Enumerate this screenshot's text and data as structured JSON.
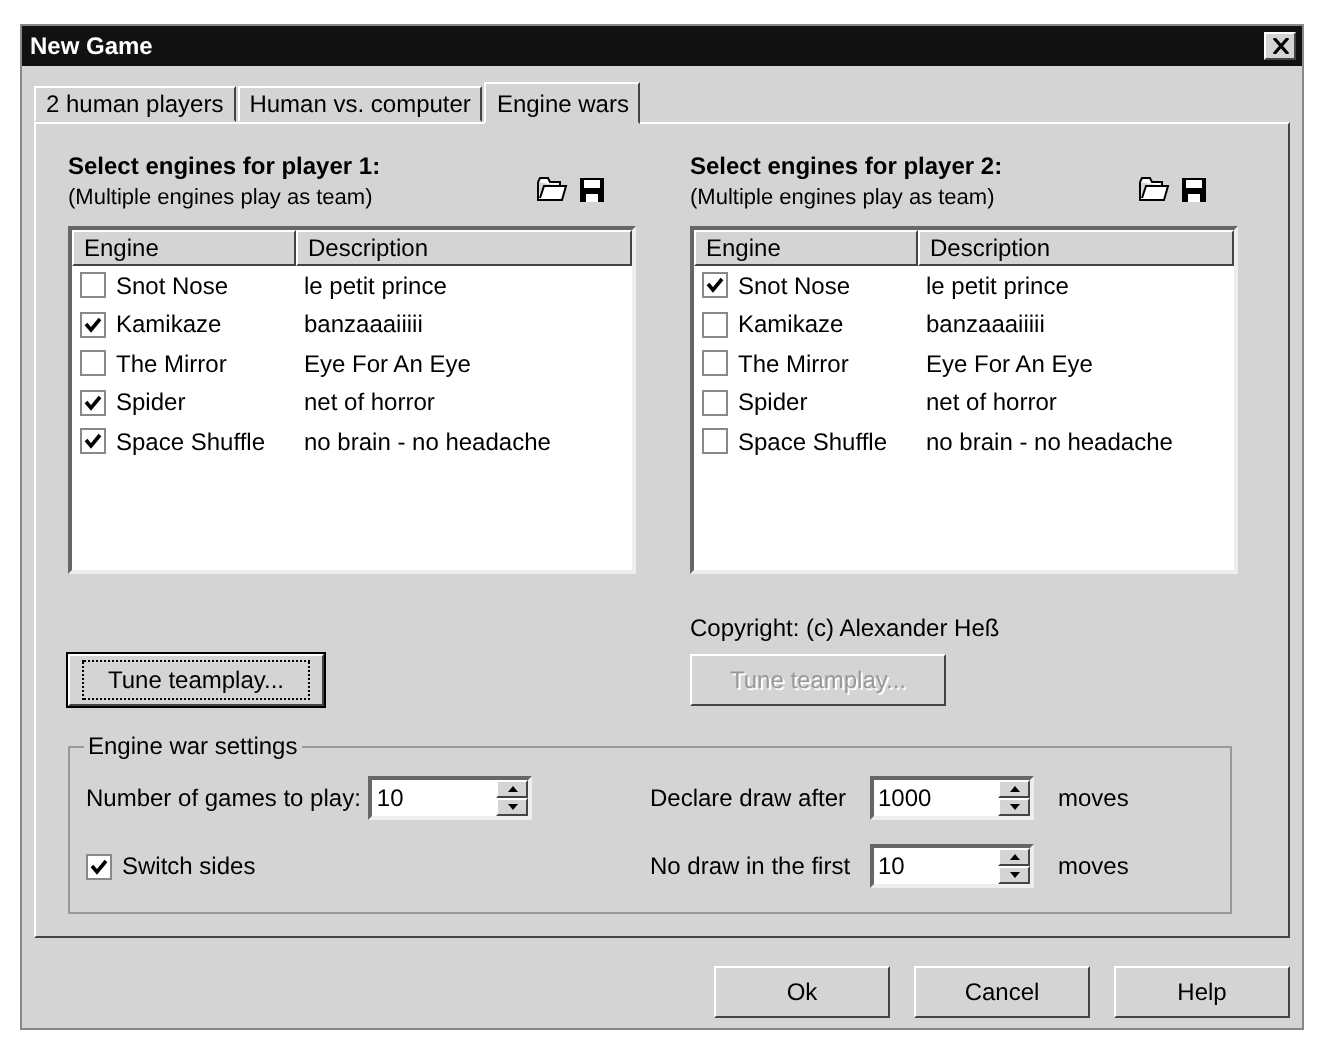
{
  "window": {
    "title": "New Game"
  },
  "tabs": [
    {
      "label": "2 human players",
      "selected": false
    },
    {
      "label": "Human vs. computer",
      "selected": false
    },
    {
      "label": "Engine wars",
      "selected": true
    }
  ],
  "players": [
    {
      "title": "Select engines for player 1:",
      "subtitle": "(Multiple engines play as team)",
      "columns": [
        "Engine",
        "Description"
      ],
      "rows": [
        {
          "engine": "Snot Nose",
          "description": "le petit prince",
          "checked": false
        },
        {
          "engine": "Kamikaze",
          "description": "banzaaaiiiii",
          "checked": true
        },
        {
          "engine": "The Mirror",
          "description": "Eye For An Eye",
          "checked": false
        },
        {
          "engine": "Spider",
          "description": "net of horror",
          "checked": true
        },
        {
          "engine": "Space Shuffle",
          "description": "no brain - no headache",
          "checked": true
        }
      ],
      "tune_button": {
        "label": "Tune teamplay...",
        "disabled": false,
        "focused": true
      }
    },
    {
      "title": "Select engines for player 2:",
      "subtitle": "(Multiple engines play as team)",
      "columns": [
        "Engine",
        "Description"
      ],
      "rows": [
        {
          "engine": "Snot Nose",
          "description": "le petit prince",
          "checked": true
        },
        {
          "engine": "Kamikaze",
          "description": "banzaaaiiiii",
          "checked": false
        },
        {
          "engine": "The Mirror",
          "description": "Eye For An Eye",
          "checked": false
        },
        {
          "engine": "Spider",
          "description": "net of horror",
          "checked": false
        },
        {
          "engine": "Space Shuffle",
          "description": "no brain - no headache",
          "checked": false
        }
      ],
      "copyright": "Copyright: (c) Alexander Heß",
      "tune_button": {
        "label": "Tune teamplay...",
        "disabled": true,
        "focused": false
      }
    }
  ],
  "settings": {
    "title": "Engine war settings",
    "games": {
      "label": "Number of games to play:",
      "value": "10"
    },
    "switch_sides": {
      "label": "Switch sides",
      "checked": true
    },
    "draw_after": {
      "label": "Declare draw after",
      "value": "1000",
      "unit": "moves"
    },
    "no_draw_first": {
      "label": "No draw in the first",
      "value": "10",
      "unit": "moves"
    }
  },
  "buttons": [
    {
      "label": "Ok"
    },
    {
      "label": "Cancel"
    },
    {
      "label": "Help"
    }
  ]
}
